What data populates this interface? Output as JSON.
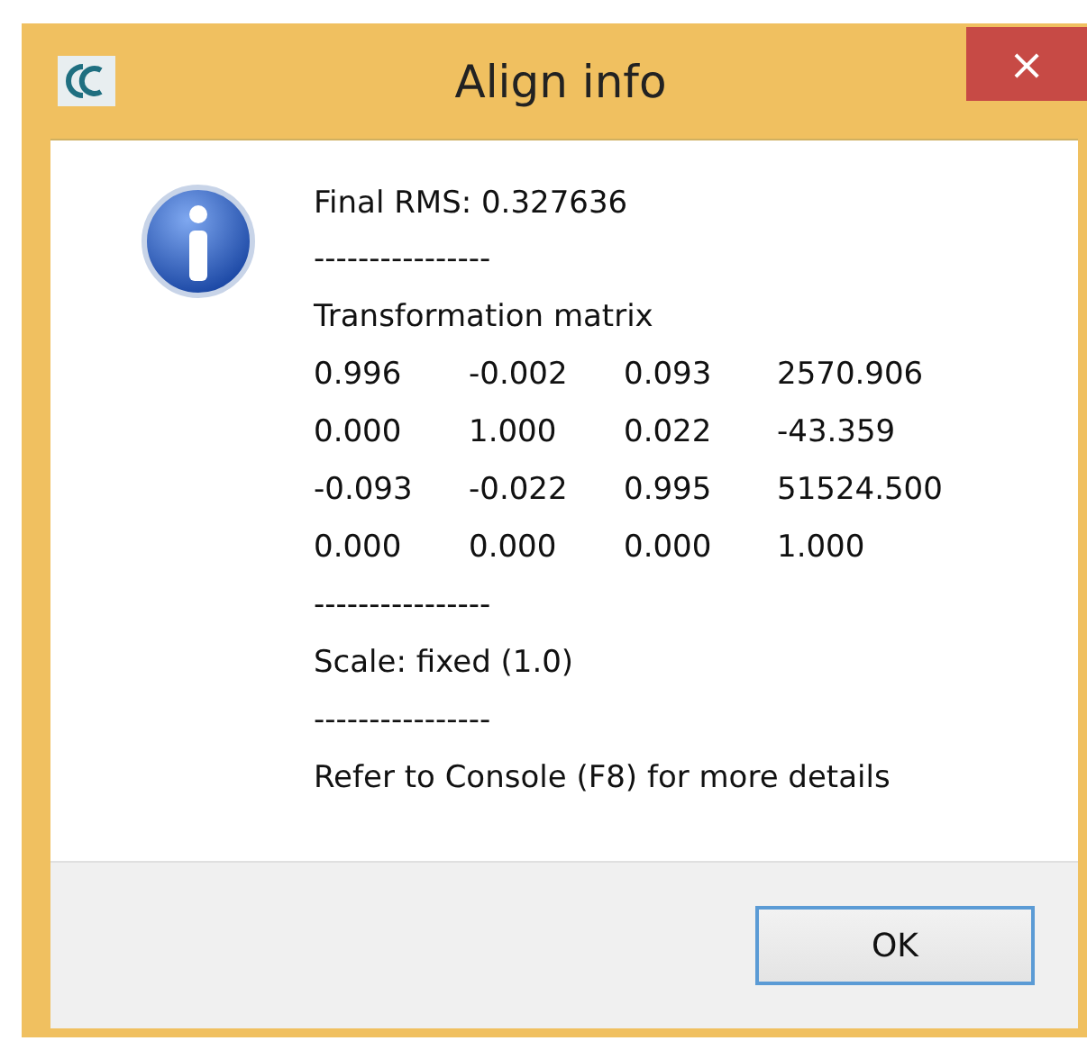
{
  "window": {
    "title": "Align info",
    "close": "×"
  },
  "message": {
    "lines": [
      {
        "kind": "text",
        "text": "Final RMS: 0.327636"
      },
      {
        "kind": "text",
        "text": "----------------"
      },
      {
        "kind": "text",
        "text": "Transformation matrix"
      },
      {
        "kind": "matrix",
        "rows": [
          [
            "0.996",
            "-0.002",
            "0.093",
            "2570.906"
          ],
          [
            "0.000",
            "1.000",
            "0.022",
            "-43.359"
          ],
          [
            "-0.093",
            "-0.022",
            "0.995",
            "51524.500"
          ],
          [
            "0.000",
            "0.000",
            "0.000",
            "1.000"
          ]
        ]
      },
      {
        "kind": "text",
        "text": "----------------"
      },
      {
        "kind": "text",
        "text": "Scale: fixed (1.0)"
      },
      {
        "kind": "text",
        "text": "----------------"
      },
      {
        "kind": "text",
        "text": "Refer to Console (F8) for more details"
      }
    ]
  },
  "buttons": [
    "OK"
  ]
}
